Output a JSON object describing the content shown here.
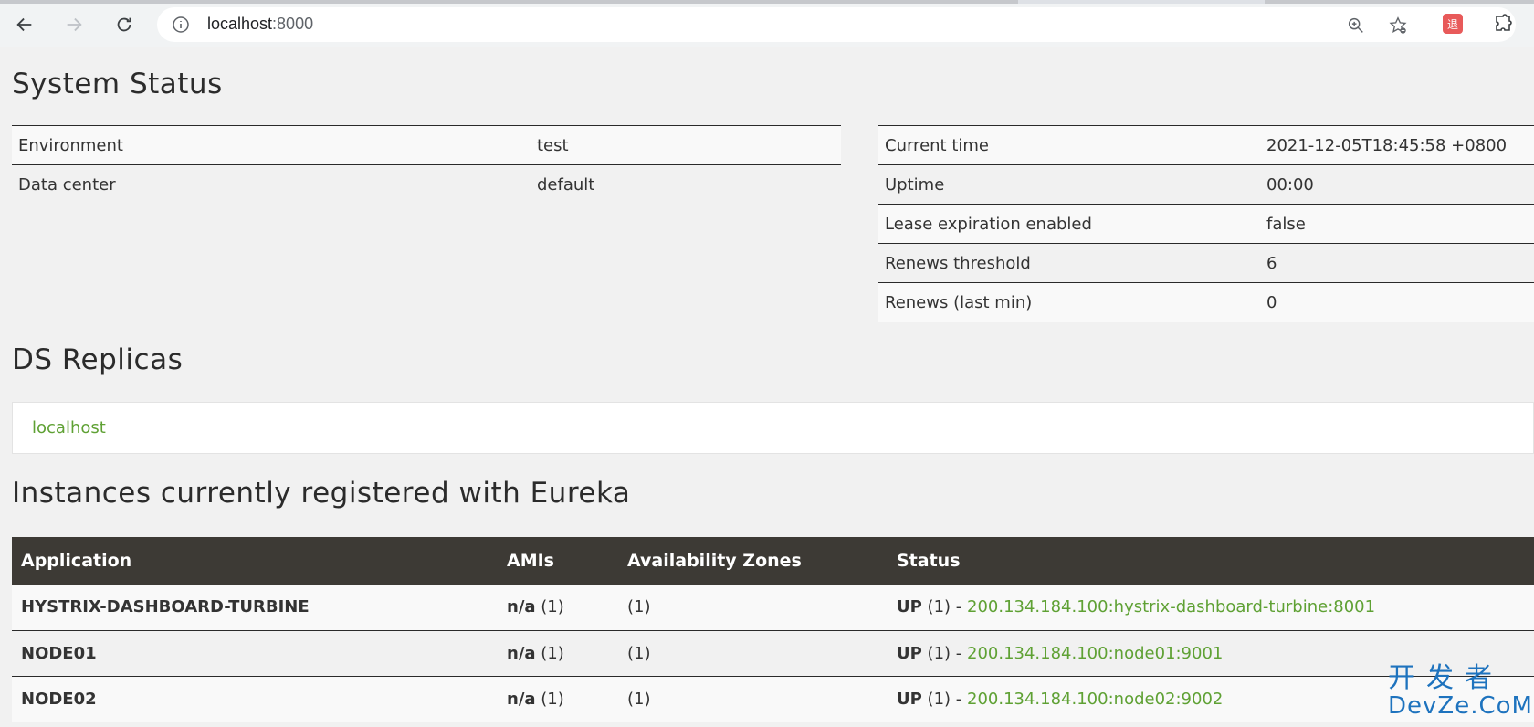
{
  "browser": {
    "url_host": "localhost",
    "url_port": ":8000",
    "extension_badge": "退"
  },
  "system_status": {
    "title": "System Status",
    "left": [
      {
        "label": "Environment",
        "value": "test"
      },
      {
        "label": "Data center",
        "value": "default"
      }
    ],
    "right": [
      {
        "label": "Current time",
        "value": "2021-12-05T18:45:58 +0800"
      },
      {
        "label": "Uptime",
        "value": "00:00"
      },
      {
        "label": "Lease expiration enabled",
        "value": "false"
      },
      {
        "label": "Renews threshold",
        "value": "6"
      },
      {
        "label": "Renews (last min)",
        "value": "0"
      }
    ]
  },
  "ds_replicas": {
    "title": "DS Replicas",
    "link": "localhost"
  },
  "instances": {
    "title": "Instances currently registered with Eureka",
    "headers": [
      "Application",
      "AMIs",
      "Availability Zones",
      "Status"
    ],
    "rows": [
      {
        "app": "HYSTRIX-DASHBOARD-TURBINE",
        "ami": "n/a",
        "ami_count": "(1)",
        "zones": "(1)",
        "status": "UP",
        "status_count": "(1) -",
        "link": "200.134.184.100:hystrix-dashboard-turbine:8001"
      },
      {
        "app": "NODE01",
        "ami": "n/a",
        "ami_count": "(1)",
        "zones": "(1)",
        "status": "UP",
        "status_count": "(1) -",
        "link": "200.134.184.100:node01:9001"
      },
      {
        "app": "NODE02",
        "ami": "n/a",
        "ami_count": "(1)",
        "zones": "(1)",
        "status": "UP",
        "status_count": "(1) -",
        "link": "200.134.184.100:node02:9002"
      }
    ]
  },
  "watermark": {
    "cn": "开发者",
    "en": "DevZe.CoM"
  }
}
